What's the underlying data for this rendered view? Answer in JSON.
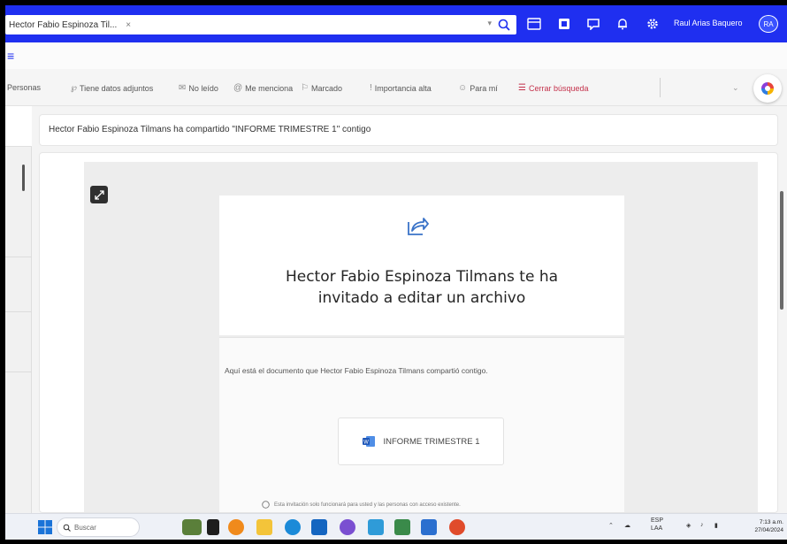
{
  "titlebar": {
    "search_value": "Hector Fabio Espinoza Til...",
    "search_clear": "×",
    "user_name": "Raul Arias Baquero",
    "user_initials": "RA",
    "accent": "#1f2ff0"
  },
  "filters": {
    "items": [
      {
        "label": "Personas",
        "icon": "person-icon"
      },
      {
        "label": "Tiene datos adjuntos",
        "icon": "paperclip-icon"
      },
      {
        "label": "No leído",
        "icon": "envelope-icon"
      },
      {
        "label": "Me menciona",
        "icon": "at-icon"
      },
      {
        "label": "Marcado",
        "icon": "flag-icon"
      },
      {
        "label": "Importancia alta",
        "icon": "exclamation-icon"
      },
      {
        "label": "Para mí",
        "icon": "person-icon"
      },
      {
        "label": "Cerrar búsqueda",
        "icon": "close-search-icon"
      }
    ]
  },
  "message": {
    "subject": "Hector Fabio Espinoza Tilmans ha compartido \"INFORME TRIMESTRE 1\" contigo",
    "card_title": "Hector Fabio Espinoza Tilmans te ha invitado a editar un archivo",
    "card_body": "Aquí está el documento que Hector Fabio Espinoza Tilmans compartió contigo.",
    "file_name": "INFORME TRIMESTRE 1",
    "note": "Esta invitación solo funcionará para usted y las personas con acceso existente."
  },
  "taskbar": {
    "search_placeholder": "Buscar",
    "lang_top": "ESP",
    "lang_bottom": "LAA",
    "time": "7:13 a.m.",
    "date": "27/04/2024"
  }
}
